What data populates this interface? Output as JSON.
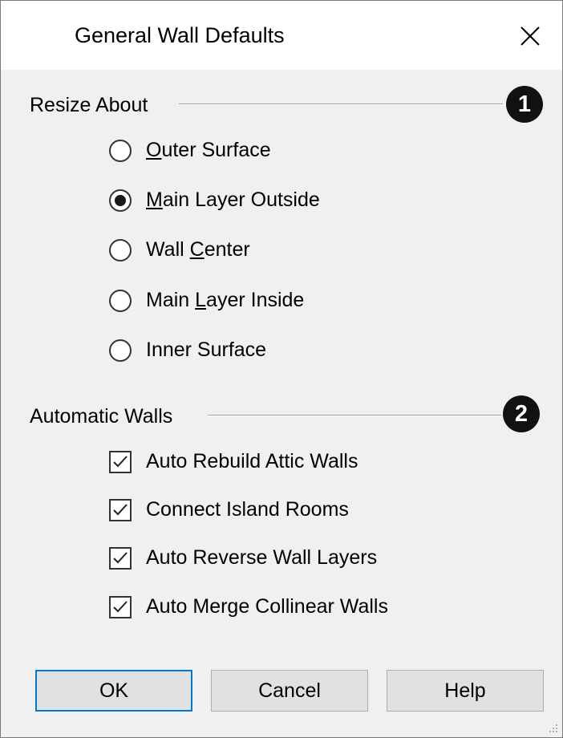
{
  "window": {
    "title": "General Wall Defaults"
  },
  "resize_about": {
    "label": "Resize About",
    "badge": "1",
    "options": [
      {
        "pre": "",
        "mnemonic": "O",
        "post": "uter Surface",
        "selected": false
      },
      {
        "pre": "",
        "mnemonic": "M",
        "post": "ain Layer Outside",
        "selected": true
      },
      {
        "pre": "Wall ",
        "mnemonic": "C",
        "post": "enter",
        "selected": false
      },
      {
        "pre": "Main ",
        "mnemonic": "L",
        "post": "ayer Inside",
        "selected": false
      },
      {
        "pre": "Inner Surface",
        "mnemonic": "",
        "post": "",
        "selected": false
      }
    ]
  },
  "automatic_walls": {
    "label": "Automatic Walls",
    "badge": "2",
    "options": [
      {
        "label": "Auto Rebuild Attic Walls",
        "checked": true
      },
      {
        "label": "Connect Island Rooms",
        "checked": true
      },
      {
        "label": "Auto Reverse Wall Layers",
        "checked": true
      },
      {
        "label": "Auto Merge Collinear Walls",
        "checked": true
      }
    ]
  },
  "buttons": {
    "ok": "OK",
    "cancel": "Cancel",
    "help": "Help"
  },
  "colors": {
    "accent": "#0078d7",
    "background": "#f0f0f0"
  }
}
